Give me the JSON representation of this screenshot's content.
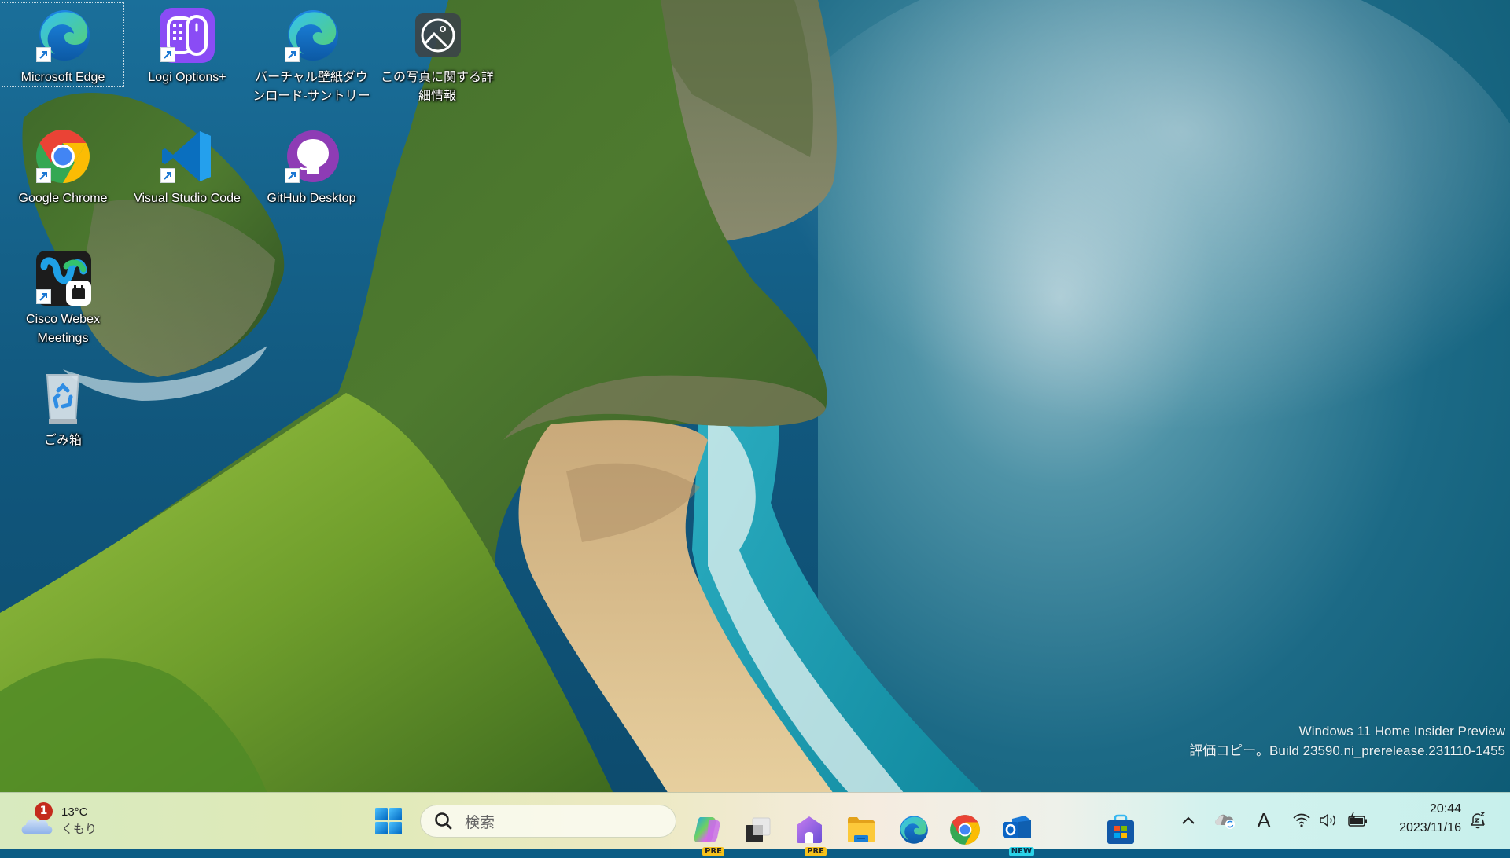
{
  "desktop": {
    "icons": [
      {
        "label": "Microsoft Edge",
        "icon": "edge-icon",
        "shortcut": true,
        "focused": true
      },
      {
        "label": "Logi Options+",
        "icon": "logi-options-icon",
        "shortcut": true
      },
      {
        "label": "バーチャル壁紙ダウンロード-サントリー",
        "icon": "edge-icon",
        "shortcut": true
      },
      {
        "label": "この写真に関する詳細情報",
        "icon": "photo-info-icon",
        "shortcut": false
      },
      {
        "label": "Google Chrome",
        "icon": "chrome-icon",
        "shortcut": true
      },
      {
        "label": "Visual Studio Code",
        "icon": "vscode-icon",
        "shortcut": true
      },
      {
        "label": "GitHub Desktop",
        "icon": "github-desktop-icon",
        "shortcut": true
      },
      {
        "label": "Cisco Webex Meetings",
        "icon": "webex-icon",
        "shortcut": true
      },
      {
        "label": "ごみ箱",
        "icon": "recycle-bin-icon",
        "shortcut": false
      }
    ],
    "watermark": {
      "line1": "Windows 11 Home Insider Preview",
      "line2": "評価コピー。Build 23590.ni_prerelease.231110-1455"
    }
  },
  "taskbar": {
    "weather": {
      "temperature": "13°C",
      "condition": "くもり",
      "badge_count": "1"
    },
    "search": {
      "placeholder": "検索"
    },
    "pinned": [
      {
        "name": "Copilot",
        "icon": "copilot-icon",
        "tag": "PRE"
      },
      {
        "name": "Task View",
        "icon": "task-view-icon"
      },
      {
        "name": "Dev Home",
        "icon": "dev-home-icon",
        "tag": "PRE"
      },
      {
        "name": "File Explorer",
        "icon": "file-explorer-icon"
      },
      {
        "name": "Microsoft Edge",
        "icon": "edge-icon"
      },
      {
        "name": "Google Chrome",
        "icon": "chrome-icon"
      },
      {
        "name": "Outlook",
        "icon": "outlook-icon",
        "tag": "NEW"
      },
      {
        "name": "Microsoft Store",
        "icon": "store-icon"
      }
    ],
    "tray": {
      "ime_mode": "A",
      "time": "20:44",
      "date": "2023/11/16"
    }
  },
  "colors": {
    "accent": "#0078d4",
    "badge": "#c42b1c",
    "tag_pre": "#f7c21a",
    "tag_new": "#2ad3e8"
  }
}
